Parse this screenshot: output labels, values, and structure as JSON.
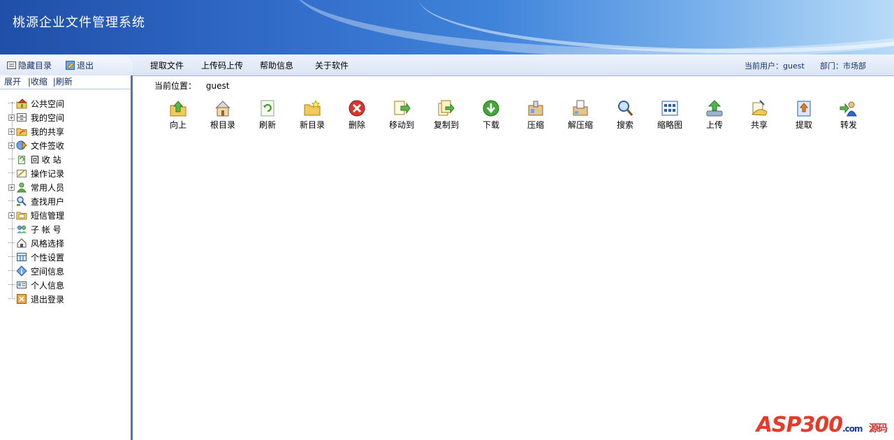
{
  "app": {
    "title": "桃源企业文件管理系统"
  },
  "nav": {
    "hide_dir": "隐藏目录",
    "exit": "退出",
    "menu": [
      "提取文件",
      "上传码上传",
      "帮助信息",
      "关于软件"
    ],
    "current_user_label": "当前用户：guest",
    "department_label": "部门：市场部"
  },
  "sidebar": {
    "expand": "展开",
    "collapse": "|收缩",
    "refresh": "|刷新",
    "items": [
      {
        "label": "公共空间",
        "expandable": false,
        "icon": "home-folder-icon"
      },
      {
        "label": "我的空间",
        "expandable": true,
        "icon": "drawer-icon"
      },
      {
        "label": "我的共享",
        "expandable": true,
        "icon": "share-folder-icon"
      },
      {
        "label": "文件签收",
        "expandable": true,
        "icon": "sign-receive-icon"
      },
      {
        "label": "回 收 站",
        "expandable": false,
        "icon": "recycle-bin-icon"
      },
      {
        "label": "操作记录",
        "expandable": false,
        "icon": "log-icon"
      },
      {
        "label": "常用人员",
        "expandable": true,
        "icon": "person-icon"
      },
      {
        "label": "查找用户",
        "expandable": false,
        "icon": "find-user-icon"
      },
      {
        "label": "短信管理",
        "expandable": true,
        "icon": "message-folder-icon"
      },
      {
        "label": "子 帐 号",
        "expandable": false,
        "icon": "sub-account-icon"
      },
      {
        "label": "风格选择",
        "expandable": false,
        "icon": "style-icon"
      },
      {
        "label": "个性设置",
        "expandable": false,
        "icon": "settings-grid-icon"
      },
      {
        "label": "空间信息",
        "expandable": false,
        "icon": "info-icon"
      },
      {
        "label": "个人信息",
        "expandable": false,
        "icon": "id-card-icon"
      },
      {
        "label": "退出登录",
        "expandable": false,
        "icon": "logout-icon"
      }
    ]
  },
  "main": {
    "location_label": "当前位置：",
    "location_value": "guest",
    "toolbar": [
      {
        "label": "向上",
        "icon": "up-folder-icon"
      },
      {
        "label": "根目录",
        "icon": "root-home-icon"
      },
      {
        "label": "刷新",
        "icon": "refresh-icon"
      },
      {
        "label": "新目录",
        "icon": "new-folder-icon"
      },
      {
        "label": "删除",
        "icon": "delete-icon"
      },
      {
        "label": "移动到",
        "icon": "move-icon"
      },
      {
        "label": "复制到",
        "icon": "copy-icon"
      },
      {
        "label": "下载",
        "icon": "download-icon"
      },
      {
        "label": "压缩",
        "icon": "compress-icon"
      },
      {
        "label": "解压缩",
        "icon": "decompress-icon"
      },
      {
        "label": "搜索",
        "icon": "search-icon"
      },
      {
        "label": "缩略图",
        "icon": "thumbnail-icon"
      },
      {
        "label": "上传",
        "icon": "upload-icon"
      },
      {
        "label": "共享",
        "icon": "share-icon"
      },
      {
        "label": "提取",
        "icon": "extract-icon"
      },
      {
        "label": "转发",
        "icon": "forward-icon"
      }
    ]
  },
  "watermark": {
    "brand": "ASP300",
    "suffix": ".com",
    "tag": "源码"
  }
}
